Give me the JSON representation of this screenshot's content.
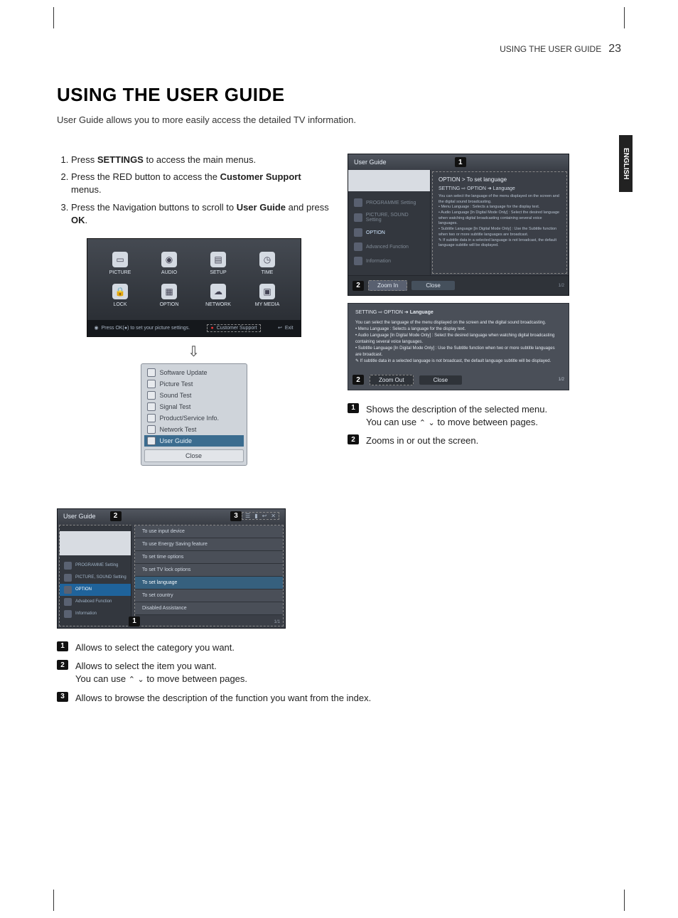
{
  "header": {
    "section": "USING THE USER GUIDE",
    "page": "23"
  },
  "lang_tab": "ENGLISH",
  "title": "USING THE USER GUIDE",
  "intro": "User Guide allows you to more easily access the detailed TV information.",
  "steps": [
    {
      "pre": "Press ",
      "b": "SETTINGS",
      "post": " to access the main menus."
    },
    {
      "pre": "Press the RED button to access the ",
      "b": "Customer Support",
      "post": " menus."
    },
    {
      "pre": "Press the Navigation buttons to scroll to ",
      "b": "User Guide",
      "post2": " and press ",
      "b2": "OK",
      "post3": "."
    }
  ],
  "main_menu": {
    "tiles": [
      "PICTURE",
      "AUDIO",
      "SETUP",
      "TIME",
      "LOCK",
      "OPTION",
      "NETWORK",
      "MY MEDIA"
    ],
    "footer_hint": "Press OK(●) to set your picture settings.",
    "footer_right": "Customer Support",
    "footer_exit": "Exit"
  },
  "popup": {
    "items": [
      "Software Update",
      "Picture Test",
      "Sound Test",
      "Signal Test",
      "Product/Service Info.",
      "Network Test",
      "User Guide"
    ],
    "selected": "User Guide",
    "close": "Close"
  },
  "guide_detail": {
    "title": "User Guide",
    "right_title": "OPTION > To set language",
    "path": "SETTING ⇨ OPTION ➜ Language",
    "path_b": "Language",
    "body_intro": "You can select the language of the menu displayed on the screen and the digital sound broadcasting.",
    "bullets": [
      "Menu Language : Selects a language for the display text.",
      "Audio Language [In Digital Mode Only] : Select the desired language when watching digital broadcasting containing several voice languages.",
      "Subtitle Language [In Digital Mode Only] : Use the Subtitle function when two or more subtitle languages are broadcast.",
      "✎ If subtitle data in a selected language is not broadcast, the default language subtitle will be displayed."
    ],
    "left_items": [
      "PROGRAMME Setting",
      "PICTURE, SOUND Setting",
      "OPTION",
      "Advanced Function",
      "Information"
    ],
    "zoom_in": "Zoom In",
    "zoom_out": "Zoom Out",
    "close": "Close",
    "page": "1/2"
  },
  "right_legend": [
    {
      "a": "Shows the description of the selected menu.",
      "b": "You can use ",
      "c": " to move between pages."
    },
    {
      "a": "Zooms in or out the screen."
    }
  ],
  "guide_list": {
    "title": "User Guide",
    "left_items": [
      "PROGRAMME Setting",
      "PICTURE, SOUND Setting",
      "OPTION",
      "Advabced Function",
      "Information"
    ],
    "left_active": "OPTION",
    "right_items": [
      "To use input device",
      "To use Energy Saving feature",
      "To set time options",
      "To set TV lock options",
      "To set language",
      "To set country",
      "Disabled Assistance"
    ],
    "right_selected": "To set language",
    "page": "1/1"
  },
  "bottom_legend": [
    {
      "a": "Allows to select the category you want."
    },
    {
      "a": "Allows to select the item you want.",
      "b": "You can use ",
      "c": " to move between pages."
    },
    {
      "a": "Allows to browse the description of the function you want from the index."
    }
  ]
}
